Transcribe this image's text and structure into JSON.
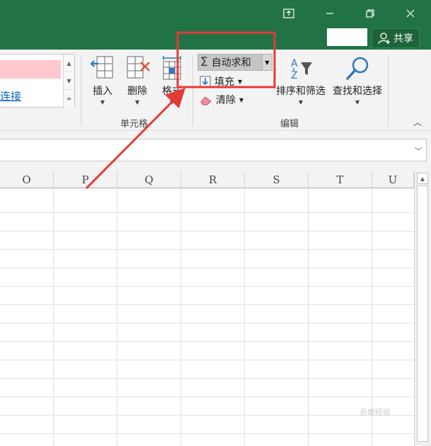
{
  "titlebar": {
    "share_label": "共享",
    "icons": [
      "ribbon-display-icon",
      "minimize-icon",
      "restore-icon",
      "close-icon"
    ]
  },
  "ribbon": {
    "styles_gallery": {
      "link_text": "连接"
    },
    "cells_group": {
      "label": "单元格",
      "insert_label": "插入",
      "delete_label": "删除",
      "format_label": "格式"
    },
    "editing_group": {
      "label": "编辑",
      "autosum_label": "自动求和",
      "fill_label": "填充",
      "clear_label": "清除",
      "sort_filter_label": "排序和筛选",
      "find_select_label": "查找和选择"
    }
  },
  "sheet": {
    "columns": [
      "O",
      "P",
      "Q",
      "R",
      "S",
      "T",
      "U"
    ]
  },
  "watermark": "百度经验",
  "colors": {
    "title_bar": "#217346",
    "annotation": "#e53935",
    "pink_style": "#ffc7ce",
    "link": "#0563c1"
  }
}
